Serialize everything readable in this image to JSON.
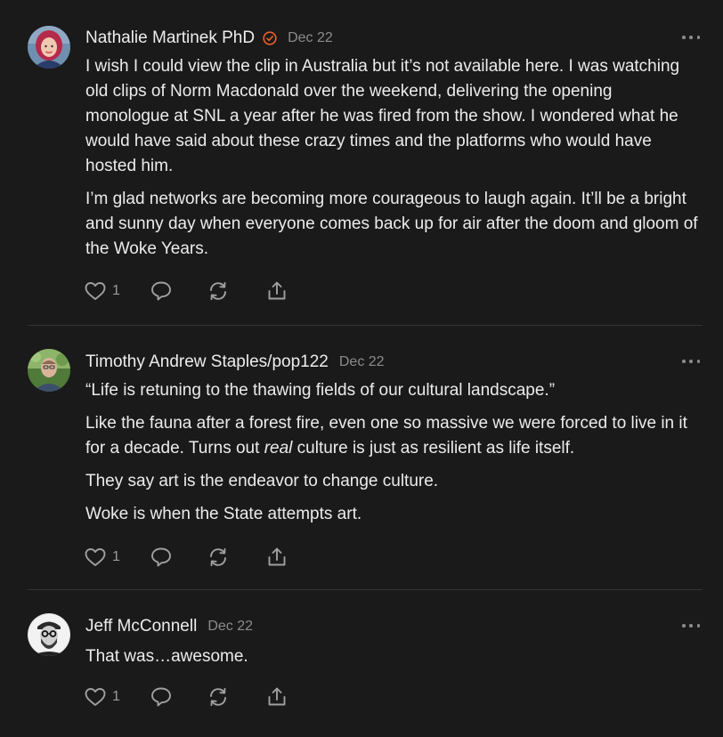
{
  "comments": [
    {
      "author": "Nathalie Martinek PhD",
      "date": "Dec 22",
      "verified": true,
      "accent_color": "#e8632a",
      "paragraphs": [
        "I wish I could view the clip in Australia but it’s not available here. I was watching old clips of Norm Macdonald over the weekend, delivering the opening monologue at SNL a year after he was fired from the show. I wondered what he would have said about these crazy times and the platforms who would have hosted him.",
        "I’m glad networks are becoming more courageous to laugh again. It’ll be a bright and sunny day when everyone comes back up for air after the doom and gloom of the Woke Years."
      ],
      "likes": "1"
    },
    {
      "author": "Timothy Andrew Staples/pop122",
      "date": "Dec 22",
      "paragraphs": [
        "“Life is retuning to the thawing fields of our cultural landscape.”",
        "They say art is the endeavor to change culture.",
        "Woke is when the State attempts art."
      ],
      "fauna_paragraph": {
        "before": "Like the fauna after a forest fire, even one so massive we were forced to live in it for a decade. Turns out ",
        "emphasis": "real",
        "after": " culture is just as resilient as life itself."
      },
      "likes": "1"
    },
    {
      "author": "Jeff McConnell",
      "date": "Dec 22",
      "paragraphs": [
        "That was…awesome."
      ],
      "likes": "1"
    }
  ],
  "icons": {
    "like": "heart-icon",
    "reply": "speech-bubble-icon",
    "restack": "restack-icon",
    "share": "share-icon",
    "more": "more-icon",
    "verified": "verified-badge-icon"
  }
}
